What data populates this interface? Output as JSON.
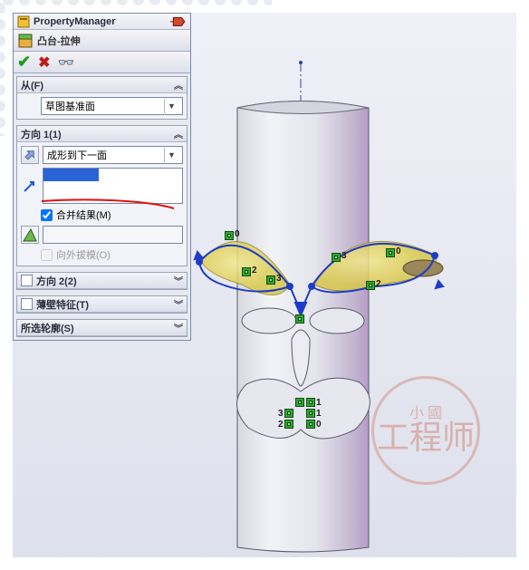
{
  "pm": {
    "title": "PropertyManager"
  },
  "feature": {
    "title": "凸台-拉伸"
  },
  "section_from": {
    "title": "从(F)",
    "start_condition": "草图基准面"
  },
  "direction1": {
    "title": "方向 1(1)",
    "end_condition": "成形到下一面",
    "merge_label": "合并结果(M)",
    "draft_label": "向外拔模(O)"
  },
  "direction2": {
    "title": "方向 2(2)"
  },
  "thin": {
    "title": "薄壁特征(T)"
  },
  "contours": {
    "title": "所选轮廓(S)"
  },
  "watermark": {
    "top": "小 國",
    "bottom": "工程师"
  },
  "sketch_labels": [
    "0",
    "0",
    "2",
    "3",
    "3",
    "0",
    "2",
    "1",
    "1",
    "3",
    "2",
    "0"
  ]
}
